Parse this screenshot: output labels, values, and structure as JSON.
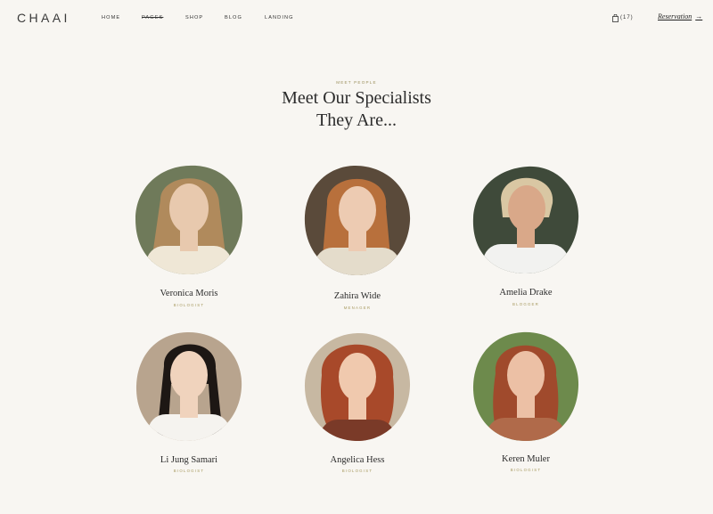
{
  "brand": {
    "logo": "CHAAI"
  },
  "nav": {
    "items": [
      "HOME",
      "PAGES",
      "SHOP",
      "BLOG",
      "LANDING"
    ],
    "active": "PAGES"
  },
  "header": {
    "cart_count": "(17)",
    "cart_icon": "shopping-bag-icon",
    "reservation_label": "Reservation",
    "reservation_icon": "arrow-right-icon"
  },
  "section": {
    "eyebrow": "MEET PEOPLE",
    "title_line1": "Meet Our Specialists",
    "title_line2": "They Are..."
  },
  "team": [
    {
      "name": "Veronica Moris",
      "role": "BIOLOGIST",
      "bg": "#6f7a5a",
      "hair": "#b08a5c",
      "skin": "#e8c9ae",
      "shirt": "#efe7d6"
    },
    {
      "name": "Zahira Wide",
      "role": "MENAGER",
      "bg": "#5a4a3a",
      "hair": "#b8703c",
      "skin": "#edcbb2",
      "shirt": "#e4dccb"
    },
    {
      "name": "Amelia Drake",
      "role": "BLOGGER",
      "bg": "#3f4a3a",
      "hair": "#d9c7a3",
      "skin": "#d9a889",
      "shirt": "#f2f2f0"
    },
    {
      "name": "Li Jung Samari",
      "role": "BIOLOGIST",
      "bg": "#b8a48e",
      "hair": "#1d1714",
      "skin": "#f0d3bd",
      "shirt": "#f5f3ef"
    },
    {
      "name": "Angelica Hess",
      "role": "BIOLOGIST",
      "bg": "#c7b8a2",
      "hair": "#a8492a",
      "skin": "#f0c9ae",
      "shirt": "#7a3a28"
    },
    {
      "name": "Keren Muler",
      "role": "BIOLOGIST",
      "bg": "#6d8a4c",
      "hair": "#a04a2c",
      "skin": "#ecc0a5",
      "shirt": "#b06a4a"
    }
  ],
  "colors": {
    "background": "#f8f6f2",
    "accent": "#a89b62",
    "text": "#2b2b2b"
  }
}
